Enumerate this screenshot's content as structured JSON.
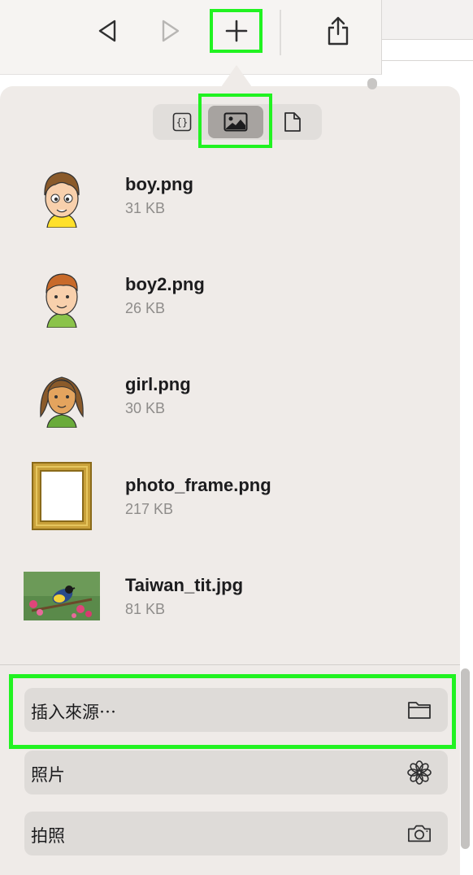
{
  "toolbar": {
    "back_icon": "back-triangle-icon",
    "forward_icon": "forward-triangle-icon",
    "add_icon": "plus-icon",
    "share_icon": "share-icon"
  },
  "segments": [
    {
      "name": "code-snippets",
      "icon": "braces-icon",
      "active": false
    },
    {
      "name": "images",
      "icon": "image-icon",
      "active": true
    },
    {
      "name": "files",
      "icon": "document-icon",
      "active": false
    }
  ],
  "files": [
    {
      "name": "boy.png",
      "size": "31 KB"
    },
    {
      "name": "boy2.png",
      "size": "26 KB"
    },
    {
      "name": "girl.png",
      "size": "30 KB"
    },
    {
      "name": "photo_frame.png",
      "size": "217 KB"
    },
    {
      "name": "Taiwan_tit.jpg",
      "size": "81 KB"
    }
  ],
  "actions": [
    {
      "label": "插入來源⋯",
      "icon": "folder-icon"
    },
    {
      "label": "照片",
      "icon": "flower-icon"
    },
    {
      "label": "拍照",
      "icon": "camera-icon"
    }
  ],
  "colors": {
    "highlight": "#21f321",
    "panel": "#efebe8",
    "action_bg": "#dedbd8"
  }
}
